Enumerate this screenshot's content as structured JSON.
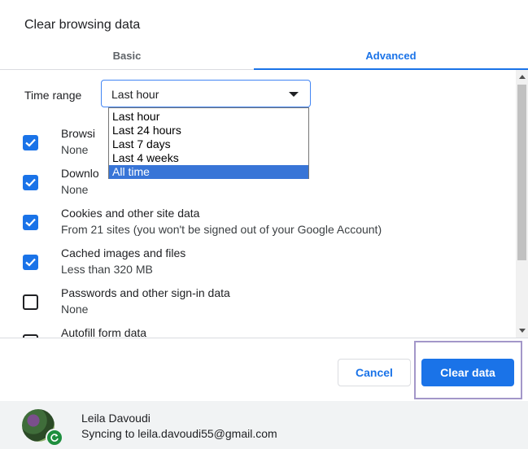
{
  "dialog": {
    "title": "Clear browsing data"
  },
  "tabs": [
    {
      "label": "Basic",
      "active": false
    },
    {
      "label": "Advanced",
      "active": true
    }
  ],
  "time_range": {
    "label": "Time range",
    "value": "Last hour",
    "options": [
      "Last hour",
      "Last 24 hours",
      "Last 7 days",
      "Last 4 weeks",
      "All time"
    ],
    "highlighted_option": "All time"
  },
  "items": [
    {
      "title": "Browsi",
      "subtitle": "None",
      "checked": true
    },
    {
      "title": "Downlo",
      "subtitle": "None",
      "checked": true
    },
    {
      "title": "Cookies and other site data",
      "subtitle": "From 21 sites (you won't be signed out of your Google Account)",
      "checked": true
    },
    {
      "title": "Cached images and files",
      "subtitle": "Less than 320 MB",
      "checked": true
    },
    {
      "title": "Passwords and other sign-in data",
      "subtitle": "None",
      "checked": false
    },
    {
      "title": "Autofill form data",
      "subtitle": "",
      "checked": false
    }
  ],
  "buttons": {
    "cancel": "Cancel",
    "clear": "Clear data"
  },
  "account": {
    "name": "Leila Davoudi",
    "sync_text": "Syncing to leila.davoudi55@gmail.com"
  },
  "colors": {
    "accent": "#1a73e8",
    "highlight_frame": "#a397c9",
    "dropdown_selection": "#3875d7"
  },
  "icons": {
    "checkbox_checked": "check-icon",
    "sync_badge": "sync-icon",
    "dropdown": "caret-down-icon"
  }
}
